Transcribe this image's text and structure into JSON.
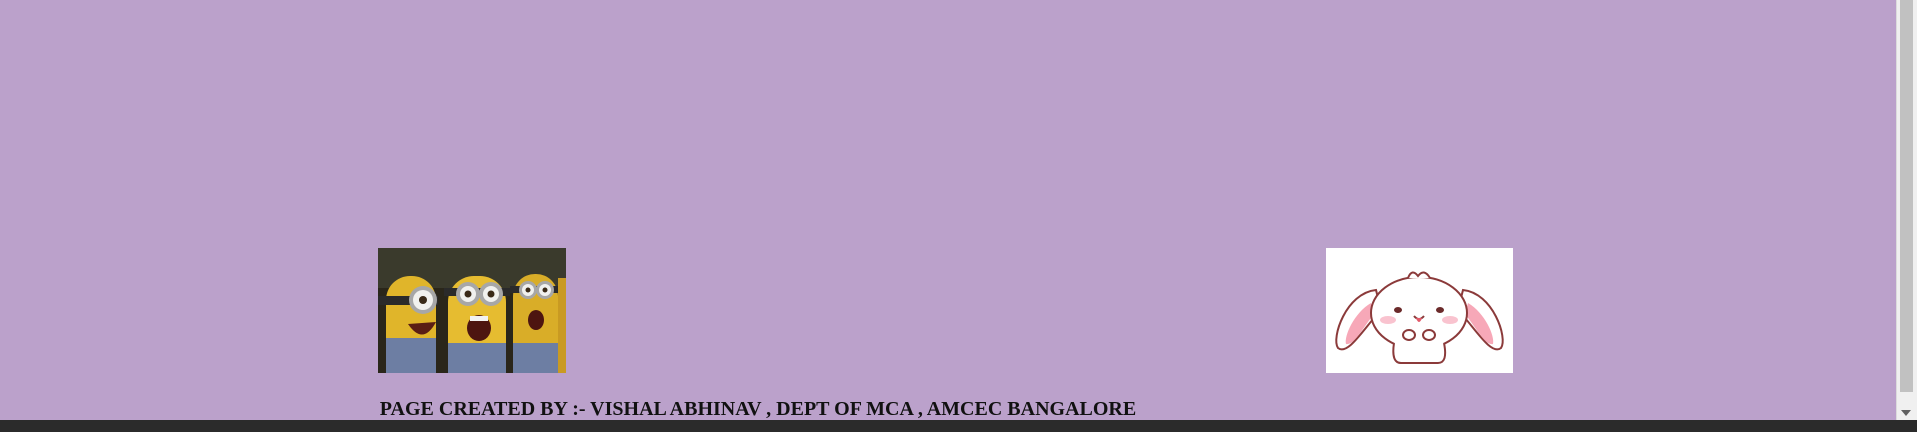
{
  "page": {
    "background_color": "#bba1cb"
  },
  "images": {
    "left": {
      "icon": "minions-laughing-gif",
      "alt": ""
    },
    "right": {
      "icon": "cute-bunny-sticker",
      "alt": ""
    }
  },
  "footer": {
    "credit_text": "PAGE CREATED BY :- VISHAL ABHINAV , DEPT OF MCA , AMCEC BANGALORE"
  }
}
